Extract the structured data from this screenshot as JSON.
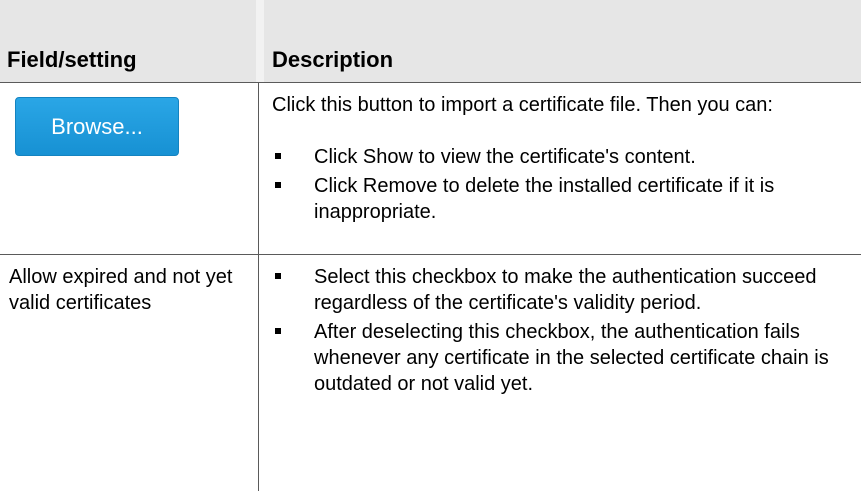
{
  "header": {
    "col_field": "Field/setting",
    "col_description": "Description"
  },
  "rows": [
    {
      "field": {
        "button_label": "Browse..."
      },
      "description": {
        "intro": "Click this button to import a certificate file. Then you can:",
        "bullets": [
          "Click Show to view the certificate's content.",
          "Click Remove to delete the installed certificate if it is inappropriate."
        ]
      }
    },
    {
      "field": {
        "text": "Allow expired and not yet valid certificates"
      },
      "description": {
        "bullets": [
          "Select this checkbox to make the authentication succeed regardless of the certificate's validity period.",
          "After deselecting this checkbox, the authentication fails whenever any certificate in the selected certificate chain is outdated or not valid yet."
        ]
      }
    }
  ],
  "colors": {
    "header_bg": "#e6e6e6",
    "button_bg": "#1791d3",
    "border": "#5a5a5a"
  }
}
